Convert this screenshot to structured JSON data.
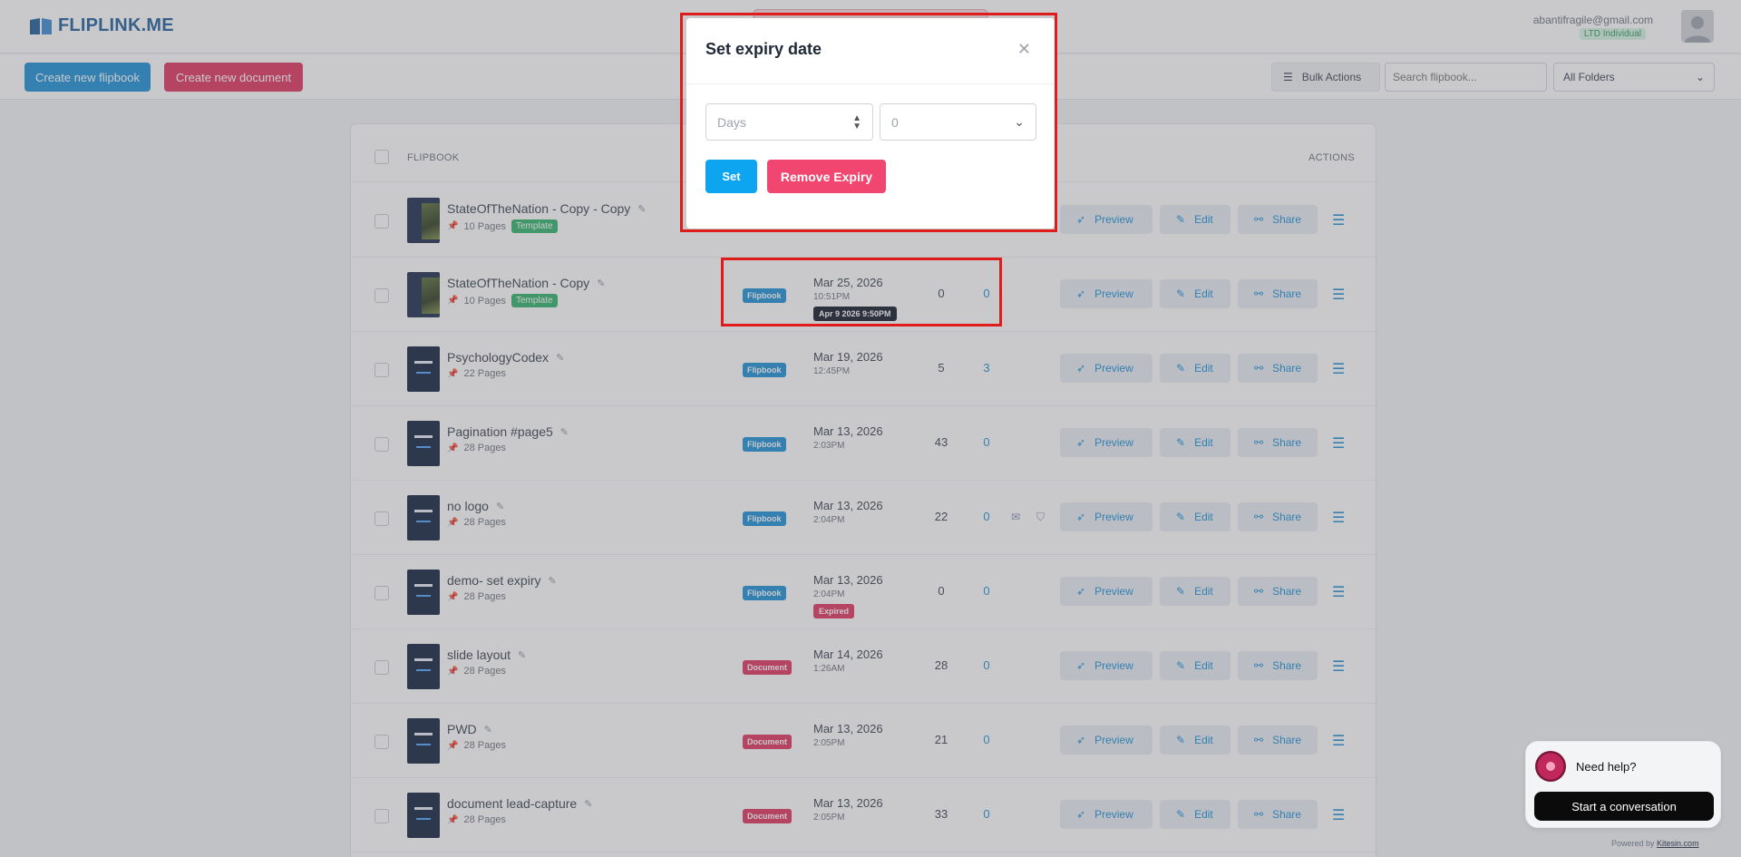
{
  "header": {
    "logo_text": "FLIPLINK.ME",
    "user_email": "abantifragile@gmail.com",
    "user_plan": "LTD Individual"
  },
  "toolbar": {
    "create_flipbook": "Create new flipbook",
    "create_document": "Create new document",
    "bulk_actions": "Bulk Actions",
    "search_placeholder": "Search flipbook...",
    "folders_selected": "All Folders"
  },
  "table": {
    "col_flipbook": "FLIPBOOK",
    "col_actions": "ACTIONS",
    "rows": [
      {
        "name": "StateOfTheNation - Copy - Copy",
        "pages": "10 Pages",
        "template": "Template"
      },
      {
        "name": "StateOfTheNation - Copy",
        "pages": "10 Pages",
        "template": "Template",
        "type": "Flipbook",
        "date": "Mar 25, 2026",
        "time": "10:51PM",
        "expiry": "Apr 9 2026 9:50PM",
        "views": "0",
        "leads": "0"
      },
      {
        "name": "PsychologyCodex",
        "pages": "22 Pages",
        "type": "Flipbook",
        "date": "Mar 19, 2026",
        "time": "12:45PM",
        "views": "5",
        "leads": "3"
      },
      {
        "name": "Pagination #page5",
        "pages": "28 Pages",
        "type": "Flipbook",
        "date": "Mar 13, 2026",
        "time": "2:03PM",
        "views": "43",
        "leads": "0"
      },
      {
        "name": "no logo",
        "pages": "28 Pages",
        "type": "Flipbook",
        "date": "Mar 13, 2026",
        "time": "2:04PM",
        "views": "22",
        "leads": "0"
      },
      {
        "name": "demo- set expiry",
        "pages": "28 Pages",
        "type": "Flipbook",
        "date": "Mar 13, 2026",
        "time": "2:04PM",
        "expired": "Expired",
        "views": "0",
        "leads": "0"
      },
      {
        "name": "slide layout",
        "pages": "28 Pages",
        "type": "Document",
        "date": "Mar 14, 2026",
        "time": "1:26AM",
        "views": "28",
        "leads": "0"
      },
      {
        "name": "PWD",
        "pages": "28 Pages",
        "type": "Document",
        "date": "Mar 13, 2026",
        "time": "2:05PM",
        "views": "21",
        "leads": "0"
      },
      {
        "name": "document lead-capture",
        "pages": "28 Pages",
        "type": "Document",
        "date": "Mar 13, 2026",
        "time": "2:05PM",
        "views": "33",
        "leads": "0"
      }
    ],
    "action_preview": "Preview",
    "action_edit": "Edit",
    "action_share": "Share"
  },
  "modal": {
    "title": "Set expiry date",
    "unit_placeholder": "Days",
    "amount_value": "0",
    "set_label": "Set",
    "remove_label": "Remove Expiry"
  },
  "help": {
    "title": "Need help?",
    "button": "Start a conversation",
    "powered_prefix": "Powered by",
    "powered_link": "Kitesin.com"
  },
  "colors": {
    "primary": "#1a8fd8",
    "danger": "#e0335f",
    "highlight": "#e01b1b"
  }
}
